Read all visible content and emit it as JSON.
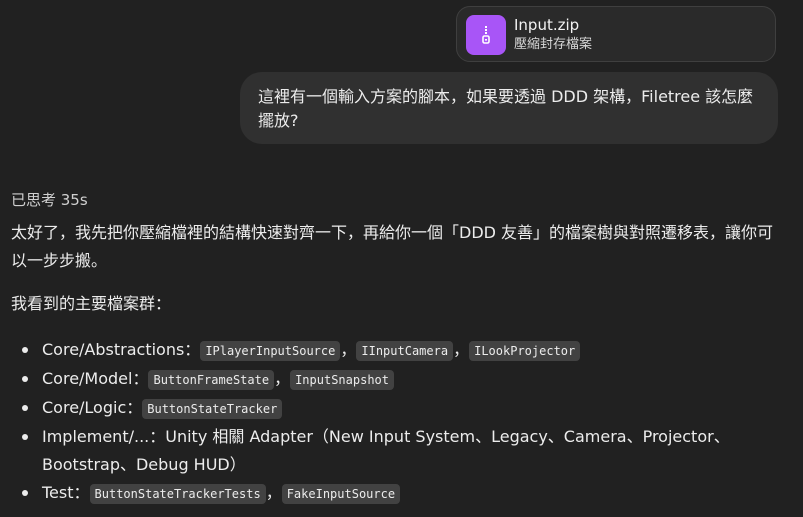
{
  "attachment": {
    "file_name": "Input.zip",
    "file_type": "壓縮封存檔案",
    "icon": "zip-file-icon",
    "icon_color": "#a855f7"
  },
  "user_message": {
    "text": "這裡有一個輸入方案的腳本，如果要透過 DDD 架構，Filetree 該怎麼擺放?"
  },
  "assistant": {
    "thinking_label": "已思考 35s",
    "intro": "太好了，我先把你壓縮檔裡的結構快速對齊一下，再給你一個「DDD 友善」的檔案樹與對照遷移表，讓你可以一步步搬。",
    "files_heading": "我看到的主要檔案群：",
    "bullets": {
      "abstractions": {
        "prefix": "Core/Abstractions：",
        "code1": "IPlayerInputSource",
        "sep1": "，",
        "code2": "IInputCamera",
        "sep2": "，",
        "code3": "ILookProjector"
      },
      "model": {
        "prefix": "Core/Model：",
        "code1": "ButtonFrameState",
        "sep1": "，",
        "code2": "InputSnapshot"
      },
      "logic": {
        "prefix": "Core/Logic：",
        "code1": "ButtonStateTracker"
      },
      "implement": {
        "text": "Implement/...：Unity 相關 Adapter（New Input System、Legacy、Camera、Projector、Bootstrap、Debug HUD）"
      },
      "test": {
        "prefix": "Test：",
        "code1": "ButtonStateTrackerTests",
        "sep1": "，",
        "code2": "FakeInputSource"
      }
    }
  }
}
